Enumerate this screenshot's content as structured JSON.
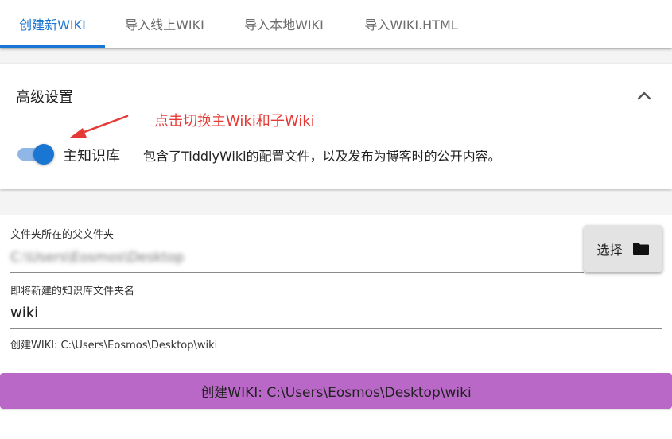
{
  "tabs": [
    {
      "label": "创建新WIKI",
      "active": true
    },
    {
      "label": "导入线上WIKI",
      "active": false
    },
    {
      "label": "导入本地WIKI",
      "active": false
    },
    {
      "label": "导入WIKI.HTML",
      "active": false
    }
  ],
  "advanced": {
    "title": "高级设置",
    "annotation": "点击切换主Wiki和子Wiki",
    "toggle_label": "主知识库",
    "toggle_checked": true,
    "toggle_description": "包含了TiddlyWiki的配置文件，以及发布为博客时的公开内容。"
  },
  "form": {
    "parent_folder_label": "文件夹所在的父文件夹",
    "parent_folder_value": "C:\\Users\\Eosmos\\Desktop",
    "choose_button_label": "选择",
    "folder_name_label": "即将新建的知识库文件夹名",
    "folder_name_value": "wiki",
    "helper_text": "创建WIKI: C:\\Users\\Eosmos\\Desktop\\wiki"
  },
  "create_button_label": "创建WIKI: C:\\Users\\Eosmos\\Desktop\\wiki",
  "colors": {
    "primary": "#1976d2",
    "accent_purple": "#ba68c8",
    "annotation_red": "#e53935"
  },
  "icons": {
    "collapse": "chevron-up-icon",
    "choose": "folder-icon",
    "annotation": "arrow-icon"
  }
}
